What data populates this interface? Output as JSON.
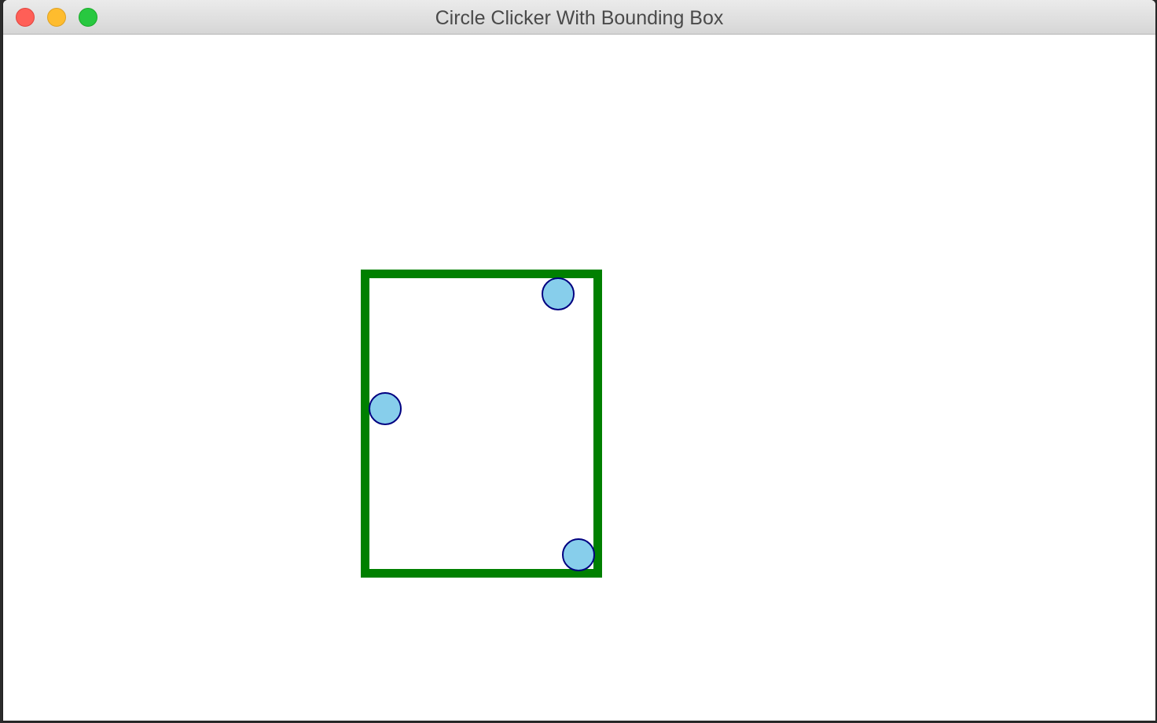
{
  "window": {
    "title": "Circle Clicker With Bounding Box"
  },
  "colors": {
    "bounding_box": "#008000",
    "circle_fill": "#87ceeb",
    "circle_stroke": "#000080",
    "close_button": "#ff5f57",
    "minimize_button": "#febc2e",
    "maximize_button": "#28c840"
  },
  "icons": {
    "close": "close-traffic-light",
    "minimize": "minimize-traffic-light",
    "maximize": "maximize-traffic-light"
  }
}
